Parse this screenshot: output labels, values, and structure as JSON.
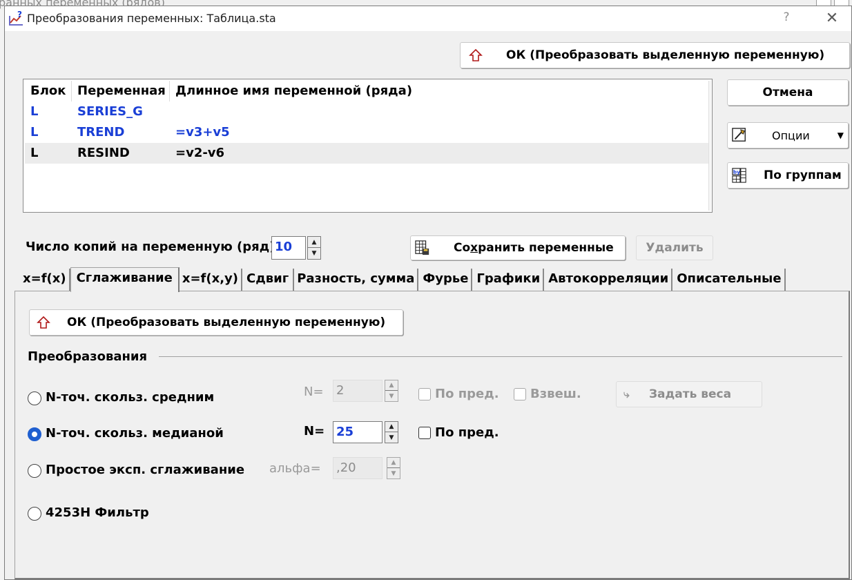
{
  "background": {
    "partial_text": "ранных переменных (рядов)"
  },
  "window": {
    "title": "Преобразования переменных: Таблица.sta",
    "help_label": "?",
    "close_label": "✕"
  },
  "top_ok_button": {
    "label": "ОК (Преобразовать выделенную переменную)"
  },
  "side_buttons": {
    "cancel": "Отмена",
    "options": "Опции",
    "by_group": "По группам"
  },
  "list": {
    "columns": [
      "Блок",
      "Переменная",
      "Длинное имя переменной (ряда)"
    ],
    "rows": [
      {
        "block": "L",
        "variable": "SERIES_G",
        "long_name": ""
      },
      {
        "block": "L",
        "variable": "TREND",
        "long_name": "=v3+v5"
      },
      {
        "block": "L",
        "variable": "RESIND",
        "long_name": "=v2-v6"
      }
    ]
  },
  "copies": {
    "label": "Число копий на переменную (ряд):",
    "value": "10"
  },
  "save_button": {
    "label_pre": "Со",
    "label_underline": "х",
    "label_post": "ранить переменные"
  },
  "delete_button": {
    "label": "Удалить"
  },
  "tabs": [
    {
      "label": "x=f(x)",
      "active": false
    },
    {
      "label": "Сглаживание",
      "active": true
    },
    {
      "label": "x=f(x,y)",
      "active": false
    },
    {
      "label": "Сдвиг",
      "active": false
    },
    {
      "label": "Разность, сумма",
      "active": false
    },
    {
      "label": "Фурье",
      "active": false
    },
    {
      "label": "Графики",
      "active": false
    },
    {
      "label": "Автокорреляции",
      "active": false
    },
    {
      "label": "Описательные",
      "active": false
    }
  ],
  "panel": {
    "ok_button": "ОК (Преобразовать выделенную переменную)",
    "group_title": "Преобразования",
    "options": {
      "moving_average": {
        "label": "N-точ. скольз. средним",
        "n_label": "N=",
        "n_value": "2",
        "prior_label": "По пред.",
        "weighted_label": "Взвеш.",
        "weights_button": "Задать веса",
        "checked": false
      },
      "moving_median": {
        "label": "N-точ. скольз. медианой",
        "n_label": "N=",
        "n_value": "25",
        "prior_label": "По пред.",
        "checked": true
      },
      "exp_smoothing": {
        "label": "Простое эксп. сглаживание",
        "alpha_label": "альфа=",
        "alpha_value": ",20",
        "checked": false
      },
      "filter_4253h": {
        "label": "4253H Фильтр",
        "checked": false
      }
    }
  },
  "colors": {
    "accent_blue": "#1a3fd6",
    "radio_blue": "#1f5fd0",
    "icon_red": "#b01818"
  }
}
